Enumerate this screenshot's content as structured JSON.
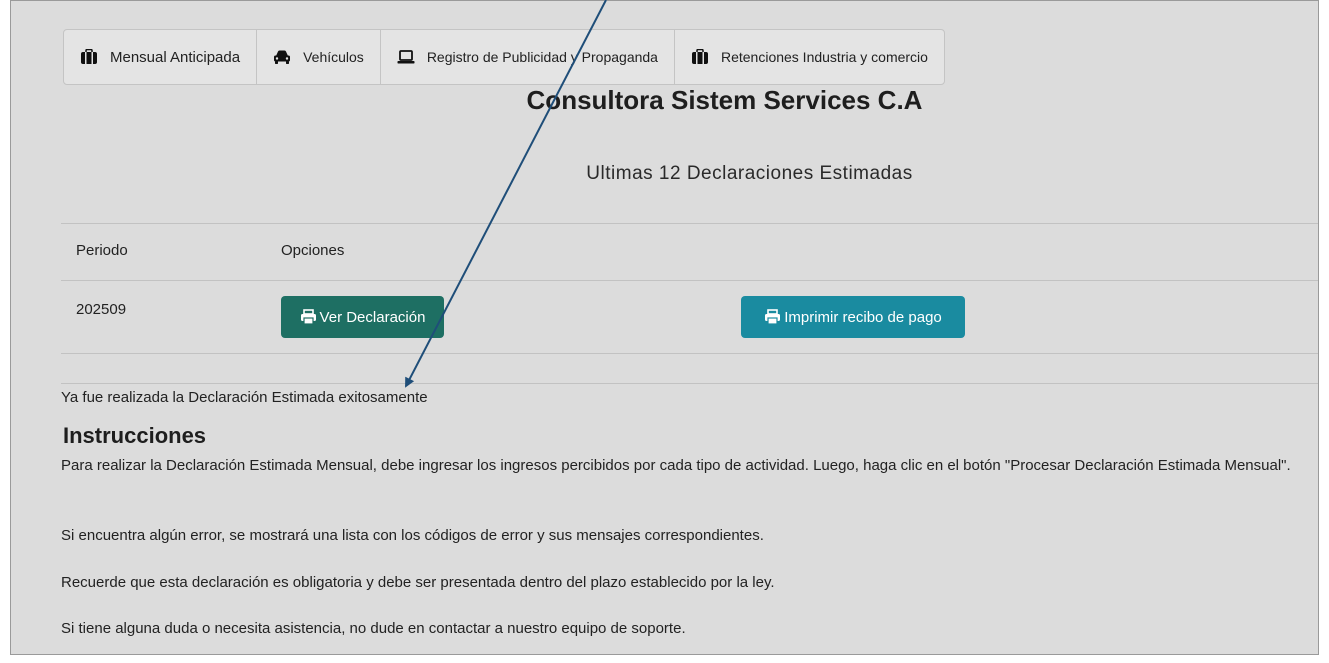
{
  "tabs": [
    {
      "label": "Mensual Anticipada",
      "icon": "briefcase-icon"
    },
    {
      "label": "Vehículos",
      "icon": "car-icon"
    },
    {
      "label": "Registro de Publicidad y Propaganda",
      "icon": "laptop-icon"
    },
    {
      "label": "Retenciones Industria y comercio",
      "icon": "briefcase-icon"
    }
  ],
  "header": {
    "company": "Consultora Sistem Services C.A",
    "subtitle": "Ultimas 12 Declaraciones Estimadas"
  },
  "table": {
    "columns": [
      "Periodo",
      "Opciones"
    ],
    "rows": [
      {
        "periodo": "202509",
        "ver_label": "Ver Declaración",
        "imprimir_label": "Imprimir recibo de pago"
      }
    ]
  },
  "status": {
    "message": "Ya fue realizada la Declaración Estimada exitosamente"
  },
  "instructions": {
    "heading": "Instrucciones",
    "paragraphs": [
      "Para realizar la Declaración Estimada Mensual, debe ingresar los ingresos percibidos por cada tipo de actividad. Luego, haga clic en el botón \"Procesar Declaración Estimada Mensual\".",
      "Si encuentra algún error, se mostrará una lista con los códigos de error y sus mensajes correspondientes.",
      "Recuerde que esta declaración es obligatoria y debe ser presentada dentro del plazo establecido por la ley.",
      "Si tiene alguna duda o necesita asistencia, no dude en contactar a nuestro equipo de soporte."
    ]
  },
  "colors": {
    "background": "#dcdcdc",
    "ver_button": "#1e6f63",
    "imprimir_button": "#1a8ba0",
    "arrow": "#1f4e79"
  }
}
